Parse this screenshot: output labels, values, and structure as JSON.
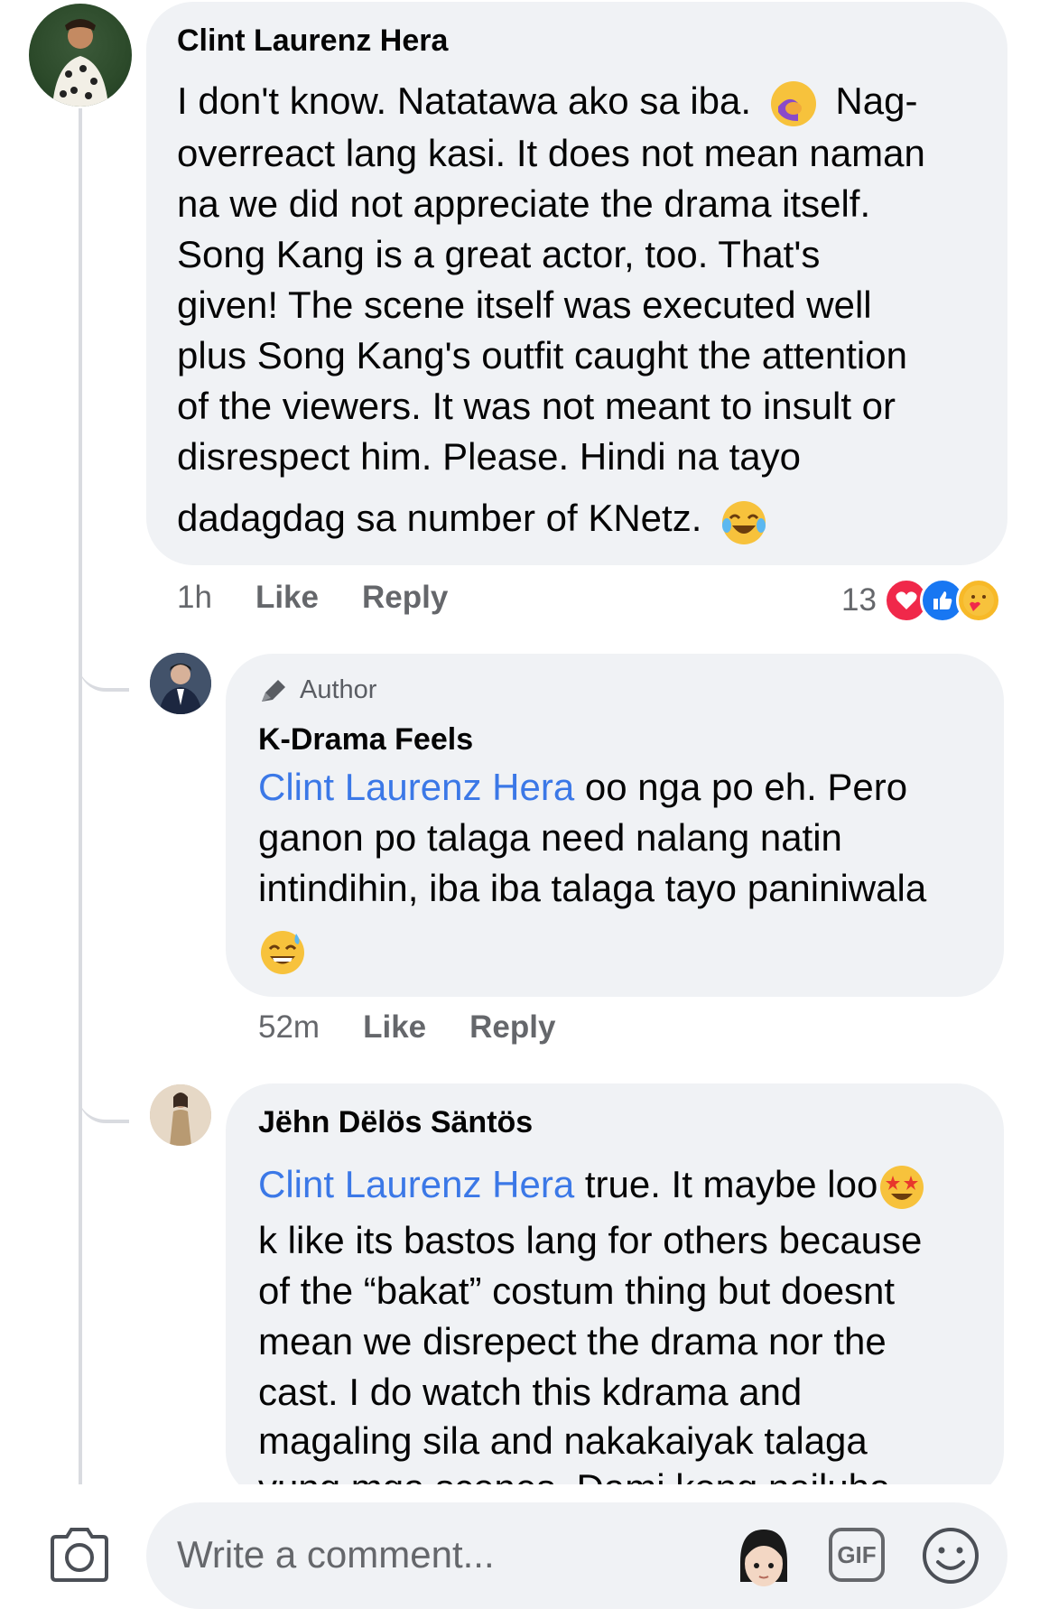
{
  "comment_main": {
    "author": "Clint Laurenz Hera",
    "lines": [
      "I don't know. Natatawa ako sa iba.",
      "Nag-",
      "overreact lang kasi. It does not mean naman",
      "na we did not appreciate the drama itself.",
      "Song Kang is a great actor, too. That's",
      "given! The scene itself was executed well",
      "plus Song Kang's outfit caught the attention",
      "of the viewers. It was not meant to insult or",
      "disrespect him. Please. Hindi na tayo",
      "dadagdag sa number of KNetz."
    ],
    "time": "1h",
    "like_label": "Like",
    "reply_label": "Reply",
    "reaction_count": "13",
    "reactions": [
      "love",
      "like",
      "care"
    ]
  },
  "reply_author": {
    "badge": "Author",
    "author": "K-Drama Feels",
    "mention": "Clint Laurenz Hera",
    "lines": [
      " oo nga po eh. Pero",
      "ganon po talaga need nalang natin",
      "intindihin, iba iba talaga tayo paniniwala"
    ],
    "time": "52m",
    "like_label": "Like",
    "reply_label": "Reply"
  },
  "reply_jehn": {
    "author": "Jëhn Dëlös Säntös",
    "mention": "Clint Laurenz Hera",
    "lines": [
      " true. It maybe loo",
      "k like its bastos lang for others because",
      "of the “bakat” costum thing but doesnt",
      "mean we disrepect the drama nor the",
      "cast. I do watch this kdrama and",
      "magaling sila and nakakaiyak talaga",
      "yung mga scenes. Dami kong nailuha"
    ]
  },
  "composer": {
    "placeholder": "Write a comment...",
    "gif_label": "GIF"
  },
  "colors": {
    "bubble": "#f0f2f5",
    "mention": "#3b78e7",
    "meta_text": "#65676b",
    "love": "#f0284a",
    "like": "#1877f2",
    "care": "#f7b928"
  },
  "icons": [
    "camera-icon",
    "memoji-avatar-icon",
    "gif-icon",
    "emoji-smile-icon",
    "pencil-icon",
    "facepalm-emoji",
    "laughing-emoji",
    "sweat-smile-emoji",
    "star-struck-emoji"
  ]
}
